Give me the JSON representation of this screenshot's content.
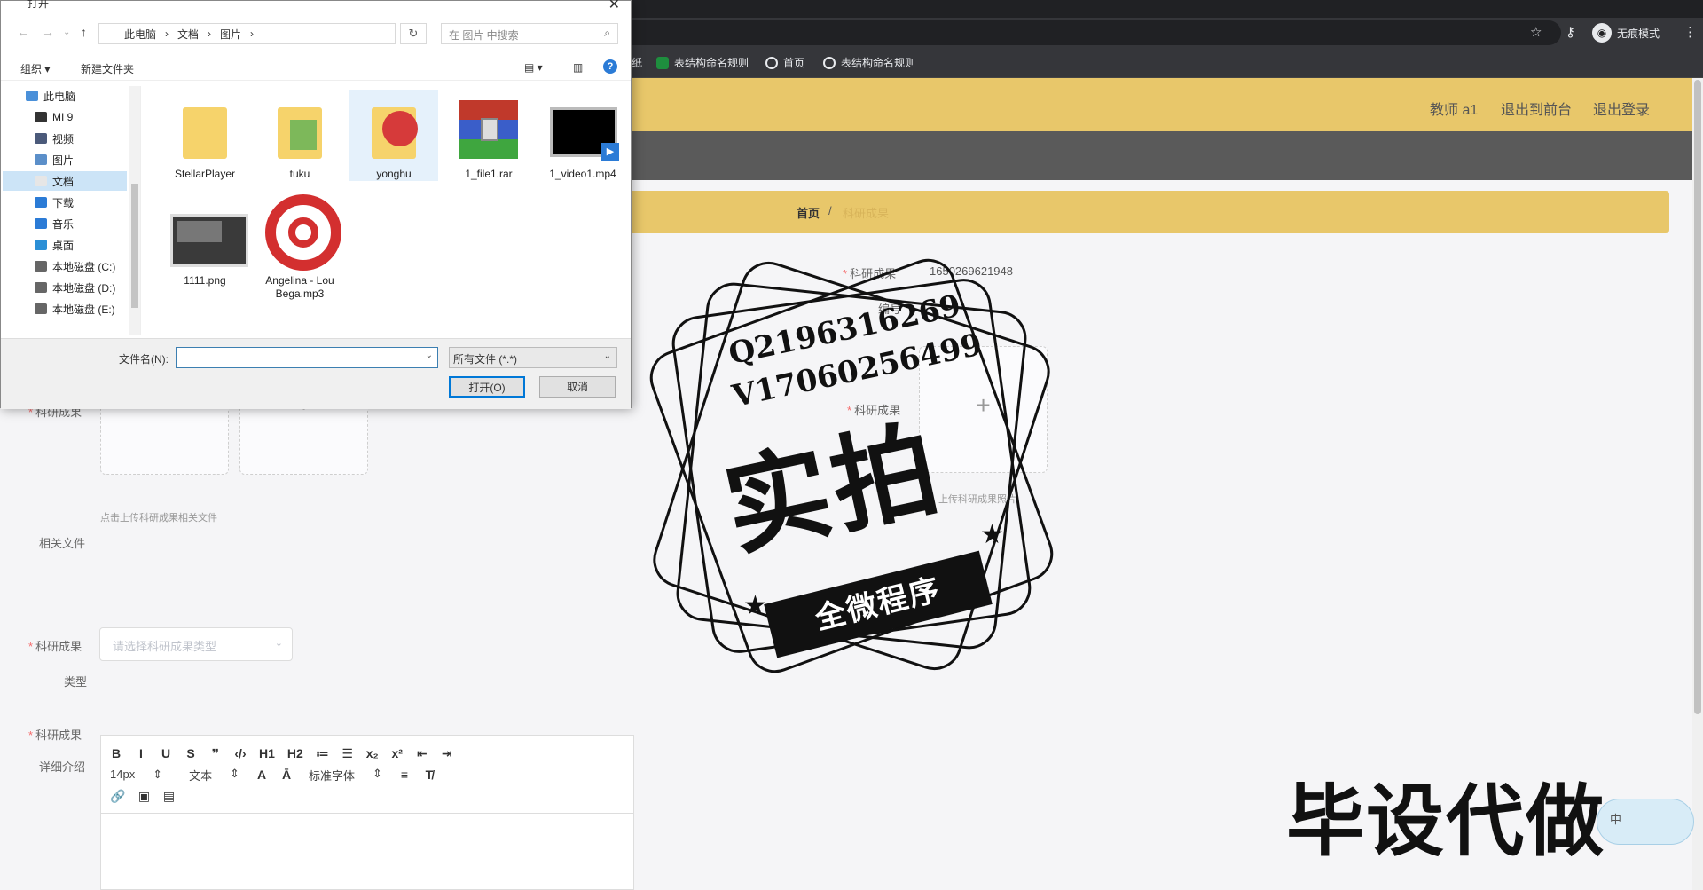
{
  "browser": {
    "incognito_label": "无痕模式",
    "bookmarks": [
      {
        "label": "纸",
        "color": "#35363a"
      },
      {
        "label": "表结构命名规则",
        "color": "#1e8e3e"
      },
      {
        "label": "首页",
        "color": "#e8eaed"
      },
      {
        "label": "表结构命名规则",
        "color": "#e8eaed"
      }
    ]
  },
  "header": {
    "user": "教师 a1",
    "back_front": "退出到前台",
    "logout": "退出登录",
    "accent_color": "#e8c76a"
  },
  "breadcrumb": {
    "home": "首页",
    "separator": "/",
    "current": "科研成果"
  },
  "form": {
    "number_label_1": "科研成果",
    "number_label_2": "编号",
    "number_value": "1650269621948",
    "image_label": "科研成果",
    "image_hint": "上传科研成果照片",
    "file_label": "科研成果",
    "file_hint": "点击上传科研成果相关文件",
    "file_label_2": "相关文件",
    "type_label_1": "科研成果",
    "type_label_2": "类型",
    "type_placeholder": "请选择科研成果类型",
    "detail_label_1": "科研成果",
    "detail_label_2": "详细介绍",
    "plus": "+"
  },
  "editor": {
    "row1": [
      "B",
      "I",
      "U",
      "S",
      "❞",
      "‹/›",
      "H1",
      "H2",
      "≔",
      "☰",
      "x₂",
      "x²",
      "⇤",
      "⇥"
    ],
    "font_size": "14px",
    "text_type": "文本",
    "font_family": "标准字体",
    "row3": [
      "🔗",
      "▣",
      "▤"
    ]
  },
  "watermark": {
    "qq": "Q2196316269",
    "wechat": "V17060256499",
    "big": "实拍",
    "ribbon": "全微程序",
    "bottom": "毕设代做",
    "ime": "中"
  },
  "dialog": {
    "title": "打开",
    "path": [
      "此电脑",
      "文档",
      "图片"
    ],
    "search_placeholder": "在 图片 中搜索",
    "organize": "组织 ▾",
    "new_folder": "新建文件夹",
    "nav_items": [
      {
        "label": "此电脑",
        "icon": "computer-icon"
      },
      {
        "label": "MI 9",
        "icon": "phone-icon"
      },
      {
        "label": "视频",
        "icon": "video-icon"
      },
      {
        "label": "图片",
        "icon": "picture-icon"
      },
      {
        "label": "文档",
        "icon": "document-icon"
      },
      {
        "label": "下载",
        "icon": "download-icon"
      },
      {
        "label": "音乐",
        "icon": "music-icon"
      },
      {
        "label": "桌面",
        "icon": "desktop-icon"
      },
      {
        "label": "本地磁盘 (C:)",
        "icon": "drive-icon"
      },
      {
        "label": "本地磁盘 (D:)",
        "icon": "drive-icon"
      },
      {
        "label": "本地磁盘 (E:)",
        "icon": "drive-icon"
      }
    ],
    "files": [
      {
        "name": "StellarPlayer",
        "kind": "folder"
      },
      {
        "name": "tuku",
        "kind": "folder-image"
      },
      {
        "name": "yonghu",
        "kind": "folder-user"
      },
      {
        "name": "1_file1.rar",
        "kind": "rar"
      },
      {
        "name": "1_video1.mp4",
        "kind": "video"
      },
      {
        "name": "1111.png",
        "kind": "image"
      },
      {
        "name": "Angelina - Lou Bega.mp3",
        "kind": "music"
      }
    ],
    "filename_label": "文件名(N):",
    "filetype": "所有文件 (*.*)",
    "open_button": "打开(O)",
    "cancel_button": "取消"
  }
}
